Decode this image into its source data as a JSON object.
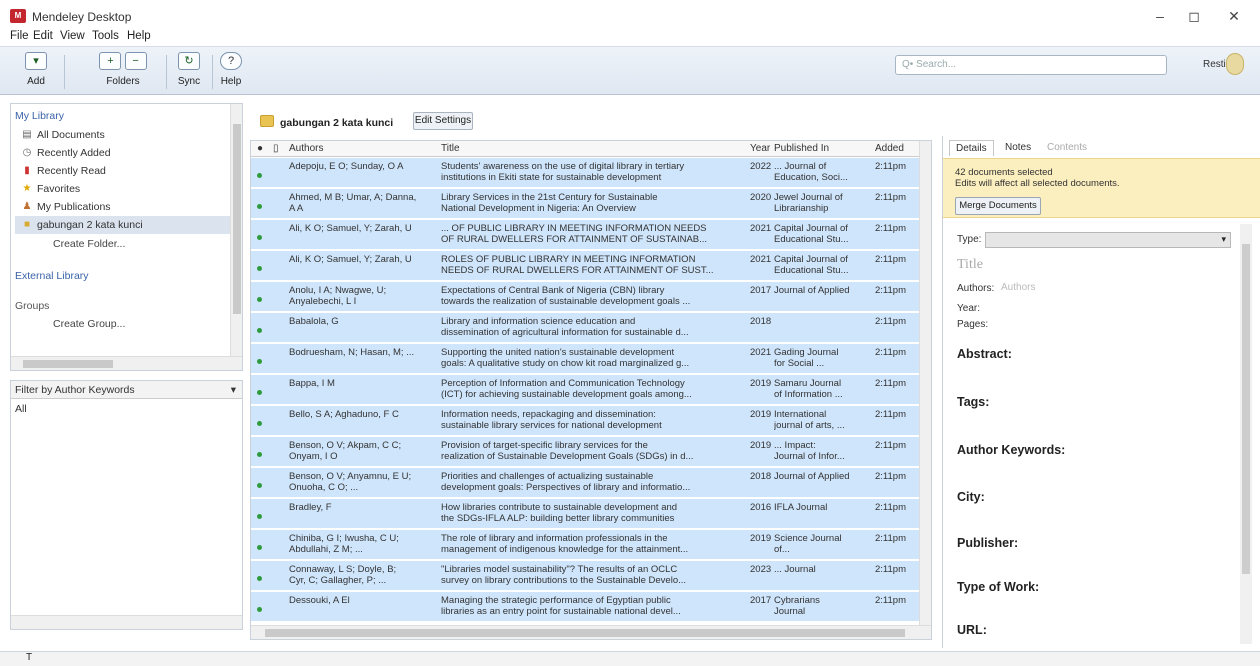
{
  "window": {
    "title": "Mendeley Desktop",
    "logo_text": "M",
    "minimize": "–",
    "maximize": "◻",
    "close": "✕"
  },
  "menu": [
    "File",
    "Edit",
    "View",
    "Tools",
    "Help"
  ],
  "toolbar": {
    "add": "Add",
    "folders": "Folders",
    "sync": "Sync",
    "help": "Help"
  },
  "search": {
    "placeholder": "Q• Search..."
  },
  "user": {
    "name": "Resti"
  },
  "sidebar": {
    "my_library": "My Library",
    "items": [
      "All Documents",
      "Recently Added",
      "Recently Read",
      "Favorites",
      "My Publications",
      "gabungan 2 kata kunci"
    ],
    "create_folder": "Create Folder...",
    "external_library": "External Library",
    "groups": "Groups",
    "create_group": "Create Group..."
  },
  "filter": {
    "selected": "Filter by Author Keywords",
    "all": "All"
  },
  "folder": {
    "title": "gabungan 2 kata kunci",
    "edit_settings": "Edit Settings"
  },
  "table": {
    "columns": {
      "authors": "Authors",
      "title": "Title",
      "year": "Year",
      "published": "Published In",
      "added": "Added"
    },
    "rows": [
      {
        "authors": "Adepoju, E O; Sunday, O A",
        "title": "Students' awareness on the use of digital library in tertiary\ninstitutions in Ekiti state for sustainable development",
        "year": "2022",
        "published": "... Journal of\nEducation, Soci...",
        "added": "2:11pm"
      },
      {
        "authors": "Ahmed, M B; Umar, A; Danna,\nA A",
        "title": "Library Services in the 21st Century for Sustainable\nNational Development in Nigeria: An Overview",
        "year": "2020",
        "published": "Jewel Journal of\nLibrarianship",
        "added": "2:11pm"
      },
      {
        "authors": "Ali, K O; Samuel, Y; Zarah, U",
        "title": "... OF PUBLIC LIBRARY IN MEETING INFORMATION NEEDS\nOF RURAL DWELLERS FOR ATTAINMENT OF SUSTAINAB...",
        "year": "2021",
        "published": "Capital Journal of\nEducational Stu...",
        "added": "2:11pm"
      },
      {
        "authors": "Ali, K O; Samuel, Y; Zarah, U",
        "title": "ROLES OF PUBLIC LIBRARY IN MEETING INFORMATION\nNEEDS OF RURAL DWELLERS FOR ATTAINMENT OF SUST...",
        "year": "2021",
        "published": "Capital Journal of\nEducational Stu...",
        "added": "2:11pm"
      },
      {
        "authors": "Anolu, I A; Nwagwe, U;\nAnyalebechi, L I",
        "title": "Expectations of Central Bank of Nigeria (CBN) library\ntowards the realization of sustainable development goals ...",
        "year": "2017",
        "published": "Journal of Applied",
        "added": "2:11pm"
      },
      {
        "authors": "Babalola, G",
        "title": "Library and information science education and\ndissemination of agricultural information for sustainable d...",
        "year": "2018",
        "published": "",
        "added": "2:11pm"
      },
      {
        "authors": "Bodruesham, N; Hasan, M; ...",
        "title": "Supporting the united nation's sustainable development\ngoals: A qualitative study on chow kit road marginalized g...",
        "year": "2021",
        "published": "Gading Journal\nfor Social ...",
        "added": "2:11pm"
      },
      {
        "authors": "Bappa, I M",
        "title": "Perception of Information and Communication Technology\n(ICT) for achieving sustainable development goals among...",
        "year": "2019",
        "published": "Samaru Journal\nof Information ...",
        "added": "2:11pm"
      },
      {
        "authors": "Bello, S A; Aghaduno, F C",
        "title": "Information needs, repackaging and dissemination:\nsustainable library services for national development",
        "year": "2019",
        "published": "International\njournal of arts, ...",
        "added": "2:11pm"
      },
      {
        "authors": "Benson, O V; Akpam, C C;\nOnyam, I O",
        "title": "Provision of target-specific library services for the\nrealization of Sustainable Development Goals (SDGs) in d...",
        "year": "2019",
        "published": "... Impact:\nJournal of Infor...",
        "added": "2:11pm"
      },
      {
        "authors": "Benson, O V; Anyamnu, E U;\nOnuoha, C O; ...",
        "title": "Priorities and challenges of actualizing sustainable\ndevelopment goals: Perspectives of library and informatio...",
        "year": "2018",
        "published": "Journal of Applied",
        "added": "2:11pm"
      },
      {
        "authors": "Bradley, F",
        "title": "How libraries contribute to sustainable development and\nthe SDGs-IFLA ALP: building better library communities",
        "year": "2016",
        "published": "IFLA Journal",
        "added": "2:11pm"
      },
      {
        "authors": "Chiniba, G I; Iwusha, C U;\nAbdullahi, Z M; ...",
        "title": "The role of library and information professionals in the\nmanagement of indigenous knowledge for the attainment...",
        "year": "2019",
        "published": "Science Journal\nof...",
        "added": "2:11pm"
      },
      {
        "authors": "Connaway, L S; Doyle, B;\nCyr, C; Gallagher, P; ...",
        "title": "\"Libraries model sustainability\"? The results of an OCLC\nsurvey on library contributions to the Sustainable Develo...",
        "year": "2023",
        "published": "... Journal",
        "added": "2:11pm"
      },
      {
        "authors": "Dessouki, A El",
        "title": "Managing the strategic performance of Egyptian public\nlibraries as an entry point for sustainable national devel...",
        "year": "2017",
        "published": "Cybrarians\nJournal",
        "added": "2:11pm"
      }
    ]
  },
  "details": {
    "tabs": [
      "Details",
      "Notes",
      "Contents"
    ],
    "notice_line1": "42 documents selected",
    "notice_line2": "Edits will affect all selected documents.",
    "merge_button": "Merge Documents",
    "type_label": "Type:",
    "title_placeholder": "Title",
    "authors_label": "Authors:",
    "authors_placeholder": "Authors",
    "year_label": "Year:",
    "pages_label": "Pages:",
    "sections": [
      "Abstract:",
      "Tags:",
      "Author Keywords:",
      "City:",
      "Publisher:",
      "Type of Work:",
      "URL:"
    ]
  }
}
